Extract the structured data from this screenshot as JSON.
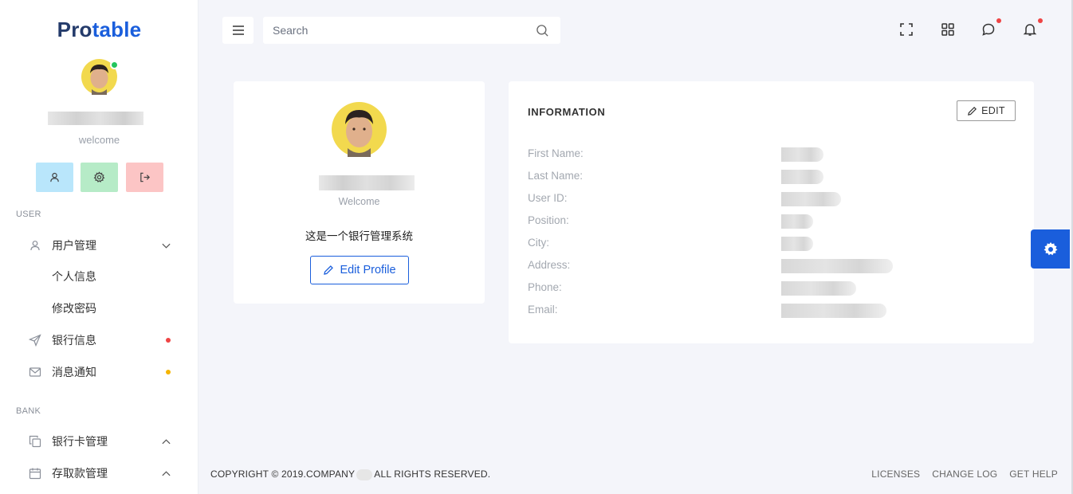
{
  "brand": {
    "part1": "Pro",
    "part2": "table"
  },
  "sidebar": {
    "welcome": "welcome",
    "sections": {
      "user": "USER",
      "bank": "BANK"
    },
    "items": [
      {
        "label": "用户管理"
      },
      {
        "label": "个人信息"
      },
      {
        "label": "修改密码"
      },
      {
        "label": "银行信息"
      },
      {
        "label": "消息通知"
      },
      {
        "label": "银行卡管理"
      },
      {
        "label": "存取款管理"
      }
    ]
  },
  "topbar": {
    "search_placeholder": "Search"
  },
  "profile": {
    "welcome": "Welcome",
    "description": "这是一个银行管理系统",
    "edit_label": "Edit Profile"
  },
  "info": {
    "title": "INFORMATION",
    "edit_label": "EDIT",
    "fields": [
      {
        "label": "First Name:"
      },
      {
        "label": "Last Name:"
      },
      {
        "label": "User ID:"
      },
      {
        "label": "Position:"
      },
      {
        "label": "City:"
      },
      {
        "label": "Address:"
      },
      {
        "label": "Phone:"
      },
      {
        "label": "Email:"
      }
    ]
  },
  "footer": {
    "copyright_left": "COPYRIGHT © 2019.COMPANY",
    "copyright_right": "ALL RIGHTS RESERVED.",
    "links": [
      "LICENSES",
      "CHANGE LOG",
      "GET HELP"
    ]
  },
  "colors": {
    "accent": "#1a5edc",
    "brand_dark": "#243b6b",
    "online": "#22c55e",
    "alert_red": "#ef4444",
    "alert_yellow": "#f5b400"
  },
  "icons": [
    "menu-icon",
    "search-icon",
    "fullscreen-icon",
    "apps-grid-icon",
    "chat-icon",
    "bell-icon",
    "user-icon",
    "gear-icon",
    "logout-icon",
    "send-icon",
    "mail-icon",
    "copy-icon",
    "calendar-icon",
    "chevron-down-icon",
    "chevron-up-icon",
    "pencil-icon"
  ]
}
